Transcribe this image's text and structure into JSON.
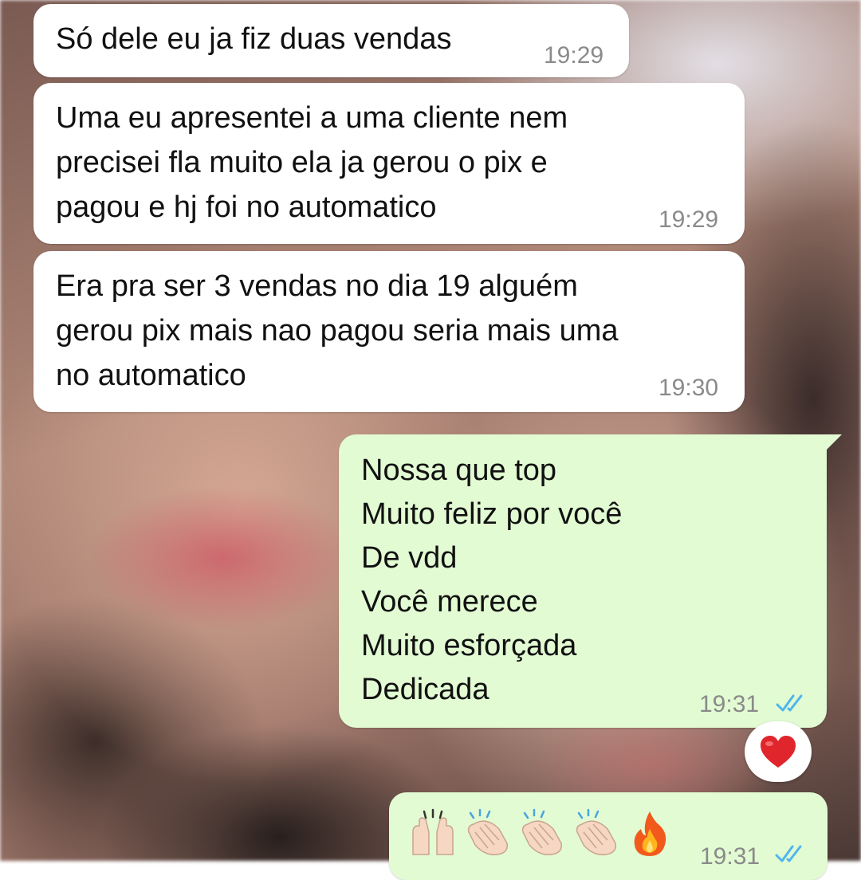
{
  "chat": {
    "messages": [
      {
        "direction": "incoming",
        "text": "Só dele eu ja fiz duas vendas",
        "time": "19:29"
      },
      {
        "direction": "incoming",
        "text": "Uma eu apresentei a uma cliente nem\nprecisei fla muito ela ja gerou o pix e\npagou e hj foi no automatico",
        "time": "19:29"
      },
      {
        "direction": "incoming",
        "text": "Era pra ser 3 vendas no dia 19 alguém\ngerou pix mais nao pagou seria mais uma\nno automatico",
        "time": "19:30"
      },
      {
        "direction": "outgoing",
        "text": "Nossa que top\nMuito feliz por você\nDe vdd\nVocê merece\nMuito esforçada\nDedicada",
        "time": "19:31",
        "status": "read",
        "reaction_icon": "red-heart-icon"
      },
      {
        "direction": "outgoing",
        "emojis": [
          "raising-hands-icon",
          "clapping-hands-icon",
          "clapping-hands-icon",
          "clapping-hands-icon",
          "fire-icon"
        ],
        "time": "19:31",
        "status": "read"
      }
    ]
  },
  "colors": {
    "incoming_bubble": "#ffffff",
    "outgoing_bubble": "#e2fbd3",
    "timestamp": "#8a8a8a",
    "read_ticks": "#4fb6ec",
    "heart": "#e0262c"
  }
}
